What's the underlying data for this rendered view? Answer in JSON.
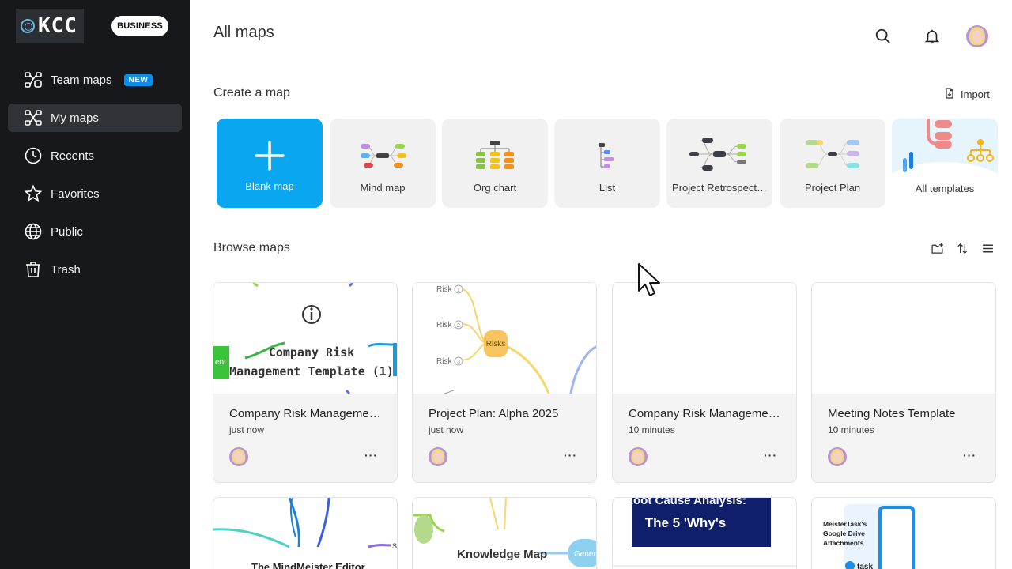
{
  "sidebar": {
    "logo_text": "KCC",
    "plan_badge": "BUSINESS",
    "items": [
      {
        "label": "Team maps",
        "icon": "team-maps-icon",
        "badge": "NEW"
      },
      {
        "label": "My maps",
        "icon": "my-maps-icon",
        "active": true
      },
      {
        "label": "Recents",
        "icon": "clock-icon"
      },
      {
        "label": "Favorites",
        "icon": "star-icon"
      },
      {
        "label": "Public",
        "icon": "globe-icon"
      },
      {
        "label": "Trash",
        "icon": "trash-icon"
      }
    ]
  },
  "header": {
    "title": "All maps"
  },
  "create": {
    "title": "Create a map",
    "import_label": "Import",
    "templates": [
      {
        "label": "Blank map"
      },
      {
        "label": "Mind map"
      },
      {
        "label": "Org chart"
      },
      {
        "label": "List"
      },
      {
        "label": "Project Retrospect…"
      },
      {
        "label": "Project Plan"
      },
      {
        "label": "All templates"
      }
    ]
  },
  "browse": {
    "title": "Browse maps",
    "maps": [
      {
        "title": "Company Risk Manageme…",
        "time": "just now",
        "preview_title": "Company Risk Management Template (1)",
        "preview_side": "ent"
      },
      {
        "title": "Project Plan: Alpha 2025",
        "time": "just now",
        "preview_node": "Risks",
        "preview_items": [
          "Risk",
          "Risk",
          "Risk"
        ],
        "preview_nums": [
          "1",
          "2",
          "3"
        ]
      },
      {
        "title": "Company Risk Manageme…",
        "time": "10 minutes"
      },
      {
        "title": "Meeting Notes Template",
        "time": "10 minutes"
      }
    ],
    "more_label": "···",
    "second_row": [
      {
        "preview_title": "The MindMeister Editor",
        "preview_side": "St"
      },
      {
        "preview_title": "Knowledge Map",
        "preview_side": "Genera"
      },
      {
        "preview_title_1": "Root Cause Analysis:",
        "preview_title_2": "The 5 'Why's"
      },
      {
        "preview_title_1": "MeisterTask's",
        "preview_title_2": "Google Drive",
        "preview_title_3": "Attachments",
        "preview_logo": "task"
      }
    ]
  },
  "colors": {
    "sidebar_bg": "#16181b",
    "accent": "#0aa6f0",
    "new_badge": "#0a8fe8"
  }
}
